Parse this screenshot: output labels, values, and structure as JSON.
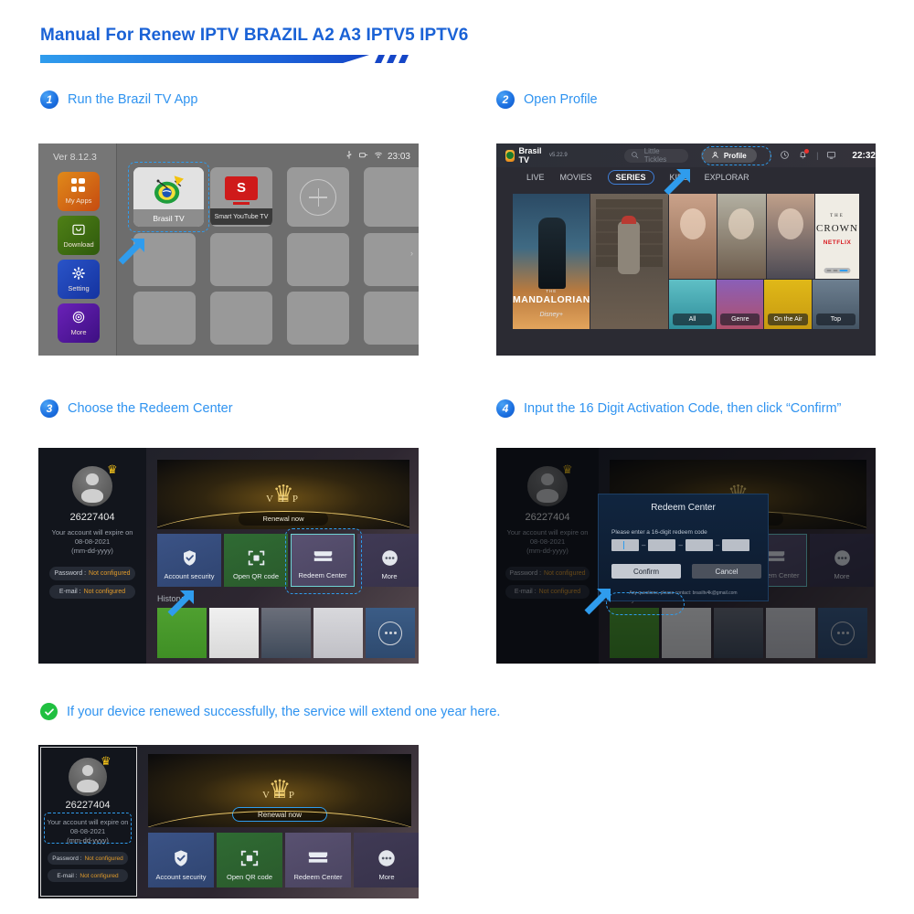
{
  "page": {
    "title": "Manual For Renew IPTV BRAZIL A2 A3 IPTV5 IPTV6",
    "accent_blue": "#1a62d6",
    "step_text_color": "#2f93f0"
  },
  "steps": [
    {
      "num": "1",
      "text": "Run the Brazil TV App"
    },
    {
      "num": "2",
      "text": "Open Profile"
    },
    {
      "num": "3",
      "text": "Choose the Redeem Center"
    },
    {
      "num": "4",
      "text": "Input the 16 Digit Activation Code, then click  “Confirm”"
    }
  ],
  "success_note": {
    "icon": "check-circle-icon",
    "text": "If your device renewed successfully, the service will extend one year here.",
    "color": "#20c040"
  },
  "launcher": {
    "version": "Ver 8.12.3",
    "status_time": "23:03",
    "status_icons": [
      "usb-icon",
      "ethernet-icon",
      "wifi-icon"
    ],
    "sidebar": [
      {
        "label": "My Apps",
        "icon": "apps-grid-icon",
        "color": "#e08a1a"
      },
      {
        "label": "Download",
        "icon": "download-bag-icon",
        "color": "#4f8016"
      },
      {
        "label": "Setting",
        "icon": "gear-icon",
        "color": "#2a54c8"
      },
      {
        "label": "More",
        "icon": "target-circle-icon",
        "color": "#6a21b8"
      }
    ],
    "apps": [
      {
        "label": "Brasil TV",
        "icon": "brasil-tv-icon",
        "selected": true
      },
      {
        "label": "Smart YouTube TV",
        "icon": "youtube-icon",
        "selected": false
      }
    ],
    "add_tile": "add-app-icon"
  },
  "brasiltv": {
    "brand": "Brasil TV",
    "brand_version": "v5.22.9",
    "search_placeholder": "Little Tickles",
    "profile_label": "Profile",
    "clock": "22:32",
    "top_icons": [
      "search-icon",
      "person-icon",
      "clock-icon",
      "bell-icon",
      "cast-icon"
    ],
    "nav": [
      {
        "label": "LIVE",
        "active": false
      },
      {
        "label": "MOVIES",
        "active": false
      },
      {
        "label": "SERIES",
        "active": true
      },
      {
        "label": "KIDS",
        "active": false
      },
      {
        "label": "EXPLORAR",
        "active": false
      }
    ],
    "posters": [
      {
        "pre": "THE",
        "title": "MANDALORIAN",
        "sub": "Disney+"
      },
      {
        "title": ""
      },
      {
        "line1": "THE",
        "line2": "CROWN",
        "badge": "NETFLIX"
      }
    ],
    "category_tiles": [
      "All",
      "Genre",
      "On the Air",
      "Top"
    ]
  },
  "profile": {
    "account_id": "26227404",
    "expire_line1": "Your account will expire on",
    "expire_line2": "08-08-2021",
    "expire_line3": "(mm-dd-yyyy)",
    "password_label": "Password :",
    "password_value": "Not configured",
    "email_label": "E-mail :",
    "email_value": "Not configured",
    "vip_word": "V I P",
    "renew_button": "Renewal now",
    "tiles": [
      {
        "label": "Account security",
        "icon": "shield-check-icon"
      },
      {
        "label": "Open QR code",
        "icon": "qr-scan-icon"
      },
      {
        "label": "Redeem Center",
        "icon": "ticket-icon"
      },
      {
        "label": "More",
        "icon": "ellipsis-icon"
      }
    ],
    "history_label": "History"
  },
  "redeem_dialog": {
    "title": "Redeem Center",
    "hint": "Please enter a 16-digit redeem code",
    "separator": "–",
    "code_boxes": [
      "",
      "",
      "",
      ""
    ],
    "confirm_label": "Confirm",
    "cancel_label": "Cancel",
    "footer": "Any questions, please contact: brasiltv4k@gmail.com"
  }
}
